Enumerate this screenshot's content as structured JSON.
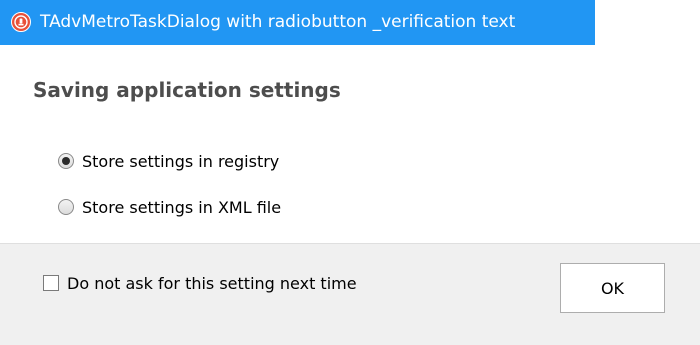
{
  "window": {
    "title": "TAdvMetroTaskDialog with radiobutton _verification text",
    "icon": "app-logo-icon",
    "titlebar_color": "#2196f3"
  },
  "dialog": {
    "heading": "Saving application settings",
    "radio_options": [
      {
        "label": "Store settings in registry",
        "selected": true
      },
      {
        "label": "Store settings in XML file",
        "selected": false
      }
    ]
  },
  "footer": {
    "verification_label": "Do not ask for this setting next time",
    "verification_checked": false,
    "ok_label": "OK"
  }
}
